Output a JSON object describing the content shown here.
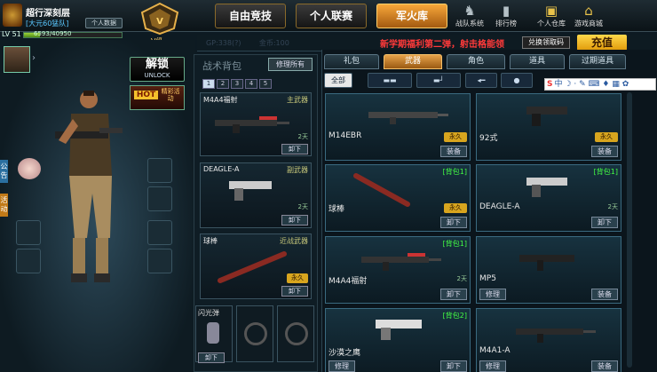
{
  "player": {
    "name": "超行深刻层",
    "group": "[大元60猛队]",
    "info_btn": "个人数据",
    "level": "LV 51",
    "exp": "6593/40950",
    "exp_fraction": 0.16,
    "rank": "V级"
  },
  "main_tabs": [
    "自由竞技",
    "个人联赛",
    "军火库"
  ],
  "top_icons": [
    {
      "label": "战队系统",
      "icon": "team-icon"
    },
    {
      "label": "排行榜",
      "icon": "rank-icon"
    },
    {
      "label": "个人仓库",
      "icon": "warehouse-icon"
    },
    {
      "label": "游戏商城",
      "icon": "shop-icon"
    }
  ],
  "header": {
    "gp": "GP:338(?)",
    "gold": "金币:100",
    "notice": "新学期福利第二弹，射击格能领",
    "notice_btn": "兑换领取码",
    "charge": "充值"
  },
  "left": {
    "unlock": "解锁",
    "unlock_sub": "UNLOCK",
    "hot": "HOT",
    "hot_sub": "精彩活动",
    "side_tabs": [
      "公告",
      "活动"
    ]
  },
  "backpack": {
    "title": "战术背包",
    "fix_btn": "修理所有",
    "pages": [
      "1",
      "2",
      "3",
      "4",
      "5"
    ],
    "slots": [
      {
        "name": "M4A4福射",
        "type": "主武器",
        "days": "2天",
        "btn": "卸下"
      },
      {
        "name": "DEAGLE-A",
        "type": "副武器",
        "days": "2天",
        "btn": "卸下"
      },
      {
        "name": "球棒",
        "type": "近战武器",
        "days": "永久",
        "btn": "卸下"
      }
    ],
    "grenade": {
      "name": "闪光弹",
      "btn": "卸下"
    }
  },
  "categories": [
    "礼包",
    "武器",
    "角色",
    "道具",
    "过期道具"
  ],
  "filters": [
    "全部",
    "rifle-icon",
    "pistol-icon",
    "knife-icon",
    "grenade-icon"
  ],
  "ime": "中",
  "items": [
    {
      "name": "M14EBR",
      "tag": "",
      "badge": "永久",
      "days": "",
      "btns": [
        "装备"
      ]
    },
    {
      "name": "92式",
      "tag": "",
      "badge": "永久",
      "days": "",
      "btns": [
        "装备"
      ]
    },
    {
      "name": "球棒",
      "tag": "[背包1]",
      "badge": "永久",
      "days": "",
      "btns": [
        "卸下"
      ]
    },
    {
      "name": "DEAGLE-A",
      "tag": "[背包1]",
      "badge": "",
      "days": "2天",
      "btns": [
        "卸下"
      ]
    },
    {
      "name": "M4A4福射",
      "tag": "[背包1]",
      "badge": "",
      "days": "2天",
      "btns": [
        "卸下"
      ]
    },
    {
      "name": "MP5",
      "tag": "",
      "badge": "",
      "days": "",
      "btns": [
        "修理",
        "装备"
      ]
    },
    {
      "name": "沙漠之鹰",
      "tag": "[背包2]",
      "badge": "",
      "days": "",
      "btns": [
        "修理",
        "卸下"
      ]
    },
    {
      "name": "M4A1-A",
      "tag": "",
      "badge": "",
      "days": "",
      "btns": [
        "修理",
        "装备"
      ]
    }
  ]
}
